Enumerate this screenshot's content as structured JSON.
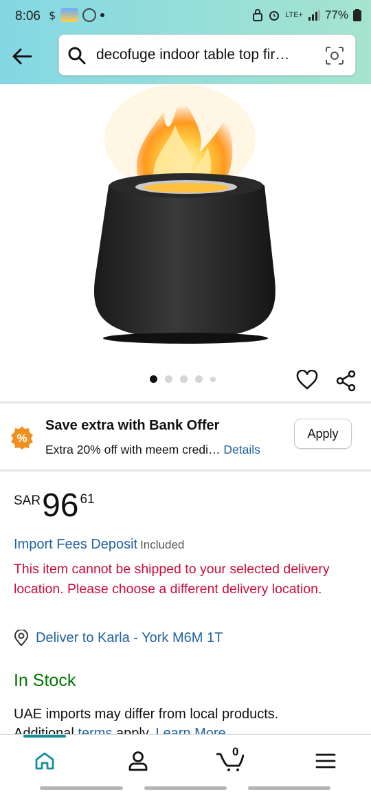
{
  "status_bar": {
    "time": "8:06",
    "network": "LTE+",
    "battery": "77%"
  },
  "search": {
    "query": "decofuge indoor table top fir…",
    "icons": [
      "back-arrow-icon",
      "search-icon",
      "camera-scan-icon"
    ]
  },
  "product_image": {
    "alt": "Black tabletop fire pit with flame",
    "carousel_count": 5,
    "active_index": 0
  },
  "offer": {
    "badge": "%",
    "title": "Save extra with Bank Offer",
    "subtitle": "Extra 20% off with meem credi…",
    "details_link": "Details",
    "apply_label": "Apply"
  },
  "price": {
    "currency": "SAR",
    "whole": "96",
    "fraction": "61"
  },
  "fees": {
    "label": "Import Fees Deposit",
    "included": "Included"
  },
  "shipping_error": "This item cannot be shipped to your selected delivery location. Please choose a different delivery location.",
  "deliver_to": "Deliver to Karla - York M6M 1T",
  "stock": "In Stock",
  "imports": {
    "text1": "UAE imports may differ from local products.",
    "text2": "Additional ",
    "terms": "terms",
    "text3": " apply. ",
    "learn_more": "Learn More"
  },
  "bottom_nav": {
    "cart_count": "0",
    "items": [
      "home-icon",
      "account-icon",
      "cart-icon",
      "menu-icon"
    ]
  },
  "colors": {
    "header_gradient_start": "#84d8e3",
    "header_gradient_end": "#a5e4cf",
    "link": "#2162a1",
    "error": "#cc0c39",
    "in_stock": "#007600",
    "offer_badge": "#f0901e",
    "nav_indicator": "#138d9c"
  }
}
